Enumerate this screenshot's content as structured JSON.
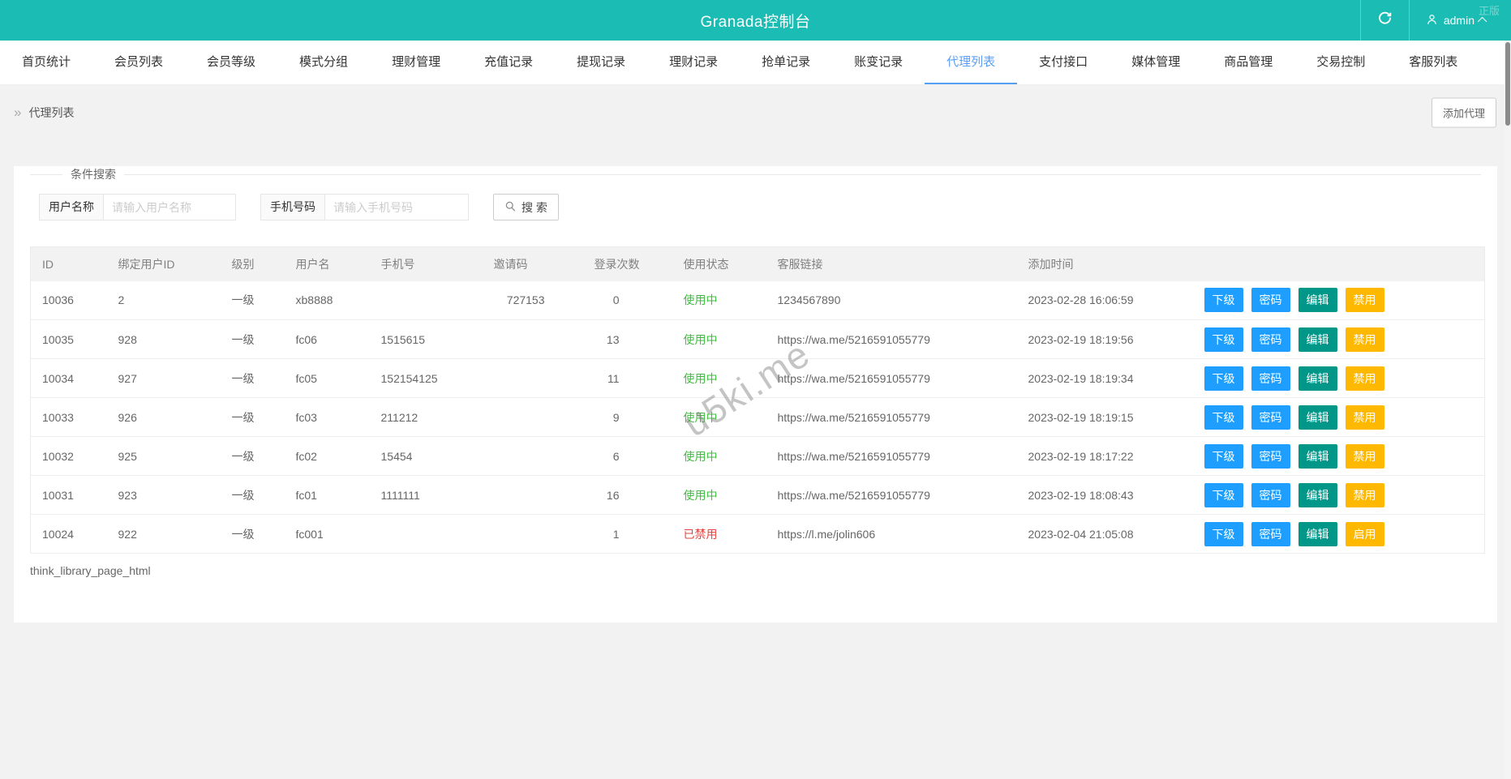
{
  "header": {
    "title": "Granada控制台",
    "username": "admin",
    "corner_watermark": "正版"
  },
  "nav": {
    "items": [
      "首页统计",
      "会员列表",
      "会员等级",
      "模式分组",
      "理财管理",
      "充值记录",
      "提现记录",
      "理财记录",
      "抢单记录",
      "账变记录",
      "代理列表",
      "支付接口",
      "媒体管理",
      "商品管理",
      "交易控制",
      "客服列表"
    ],
    "active": "代理列表"
  },
  "breadcrumb": {
    "chevron": "»",
    "label": "代理列表",
    "add_button": "添加代理"
  },
  "search": {
    "legend": "条件搜索",
    "username_label": "用户名称",
    "username_placeholder": "请输入用户名称",
    "username_value": "",
    "phone_label": "手机号码",
    "phone_placeholder": "请输入手机号码",
    "phone_value": "",
    "button": "搜 索"
  },
  "table": {
    "columns": [
      "ID",
      "绑定用户ID",
      "级别",
      "用户名",
      "手机号",
      "邀请码",
      "登录次数",
      "使用状态",
      "客服链接",
      "添加时间",
      ""
    ],
    "action_labels": {
      "sub": "下级",
      "password": "密码",
      "edit": "编辑"
    },
    "rows": [
      {
        "id": "10036",
        "bind_uid": "2",
        "level": "一级",
        "username": "xb8888",
        "phone": "",
        "invite_code": "727153",
        "login_count": "0",
        "status": "使用中",
        "status_type": "active",
        "service_link": "1234567890",
        "created_at": "2023-02-28 16:06:59",
        "toggle": "禁用"
      },
      {
        "id": "10035",
        "bind_uid": "928",
        "level": "一级",
        "username": "fc06",
        "phone": "1515615",
        "invite_code": "",
        "login_count": "13",
        "status": "使用中",
        "status_type": "active",
        "service_link": "https://wa.me/5216591055779",
        "created_at": "2023-02-19 18:19:56",
        "toggle": "禁用"
      },
      {
        "id": "10034",
        "bind_uid": "927",
        "level": "一级",
        "username": "fc05",
        "phone": "152154125",
        "invite_code": "",
        "login_count": "11",
        "status": "使用中",
        "status_type": "active",
        "service_link": "https://wa.me/5216591055779",
        "created_at": "2023-02-19 18:19:34",
        "toggle": "禁用"
      },
      {
        "id": "10033",
        "bind_uid": "926",
        "level": "一级",
        "username": "fc03",
        "phone": "211212",
        "invite_code": "",
        "login_count": "9",
        "status": "使用中",
        "status_type": "active",
        "service_link": "https://wa.me/5216591055779",
        "created_at": "2023-02-19 18:19:15",
        "toggle": "禁用"
      },
      {
        "id": "10032",
        "bind_uid": "925",
        "level": "一级",
        "username": "fc02",
        "phone": "15454",
        "invite_code": "",
        "login_count": "6",
        "status": "使用中",
        "status_type": "active",
        "service_link": "https://wa.me/5216591055779",
        "created_at": "2023-02-19 18:17:22",
        "toggle": "禁用"
      },
      {
        "id": "10031",
        "bind_uid": "923",
        "level": "一级",
        "username": "fc01",
        "phone": "1111111",
        "invite_code": "",
        "login_count": "16",
        "status": "使用中",
        "status_type": "active",
        "service_link": "https://wa.me/5216591055779",
        "created_at": "2023-02-19 18:08:43",
        "toggle": "禁用"
      },
      {
        "id": "10024",
        "bind_uid": "922",
        "level": "一级",
        "username": "fc001",
        "phone": "",
        "invite_code": "",
        "login_count": "1",
        "status": "已禁用",
        "status_type": "disabled",
        "service_link": "https://l.me/jolin606",
        "created_at": "2023-02-04 21:05:08",
        "toggle": "启用"
      }
    ],
    "footer_note": "think_library_page_html"
  },
  "watermark": "u5ki.me",
  "colors": {
    "header_teal": "#1abcb4",
    "active_tab_blue": "#5c9ef3",
    "button_blue": "#1e9fff",
    "button_green": "#009688",
    "button_orange": "#ffb800",
    "status_green": "#3dbd3d",
    "status_red": "#e6433f"
  }
}
